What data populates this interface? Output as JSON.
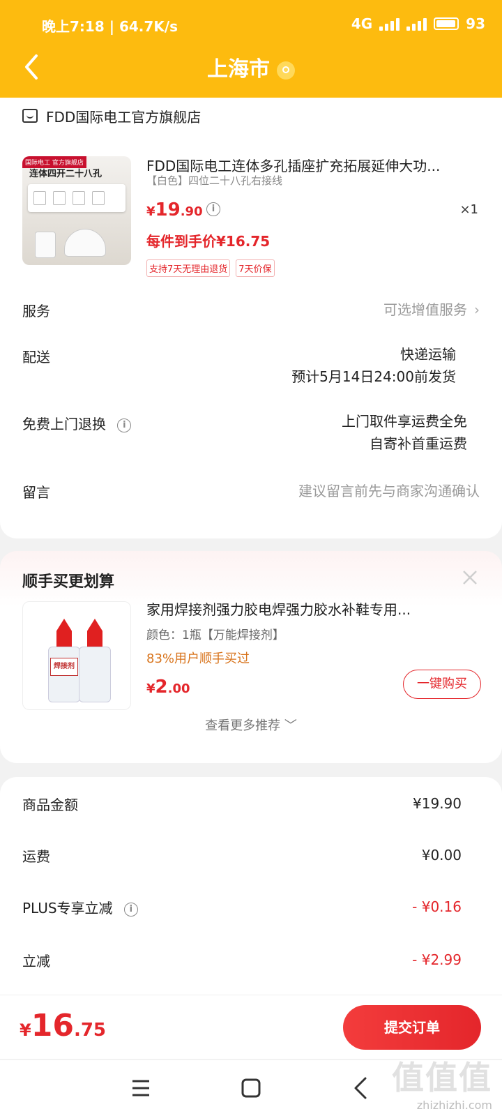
{
  "status_bar": {
    "left": "晚上7:18 | 64.7K/s",
    "network": "4G",
    "battery": "93"
  },
  "nav": {
    "title": "上海市"
  },
  "store": {
    "name": "FDD国际电工官方旗舰店"
  },
  "product": {
    "image_tag": "国际电工 官方旗舰店",
    "image_text": "连体四开二十八孔",
    "title": "FDD国际电工连体多孔插座扩充拓展延伸大功...",
    "spec": "【白色】四位二十八孔右接线",
    "price_yen": "¥",
    "price_int": "19",
    "price_dec": ".90",
    "quantity": "×1",
    "final_price": "每件到手价¥16.75",
    "badges": [
      "支持7天无理由退货",
      "7天价保"
    ]
  },
  "rows": {
    "service_label": "服务",
    "service_value": "可选增值服务",
    "delivery_label": "配送",
    "delivery_value1": "快递运输",
    "delivery_value2": "预计5月14日24:00前发货",
    "return_label": "免费上门退换",
    "return_value1": "上门取件享运费全免",
    "return_value2": "自寄补首重运费",
    "message_label": "留言",
    "message_placeholder": "建议留言前先与商家沟通确认"
  },
  "recommend": {
    "section_title": "顺手买更划算",
    "title": "家用焊接剂强力胶电焊强力胶水补鞋专用...",
    "spec": "颜色：1瓶【万能焊接剂】",
    "bought": "83%用户顺手买过",
    "bottle_label": "焊接剂",
    "price_yen": "¥",
    "price_int": "2",
    "price_dec": ".00",
    "buy_label": "一键购买",
    "more_label": "查看更多推荐 ﹀"
  },
  "summary": {
    "goods_label": "商品金额",
    "goods_value": "¥19.90",
    "shipping_label": "运费",
    "shipping_value": "¥0.00",
    "plus_label": "PLUS专享立减",
    "plus_value": "- ¥0.16",
    "discount_label": "立减",
    "discount_value": "- ¥2.99"
  },
  "bottom": {
    "total_yen": "¥",
    "total_int": "16",
    "total_dec": ".75",
    "submit_label": "提交订单"
  },
  "watermark": {
    "line1": "值值值",
    "line2": "zhizhizhi.com"
  },
  "colors": {
    "header": "#fdbb0f",
    "accent_red": "#e4262b",
    "orange_text": "#d8731b"
  }
}
